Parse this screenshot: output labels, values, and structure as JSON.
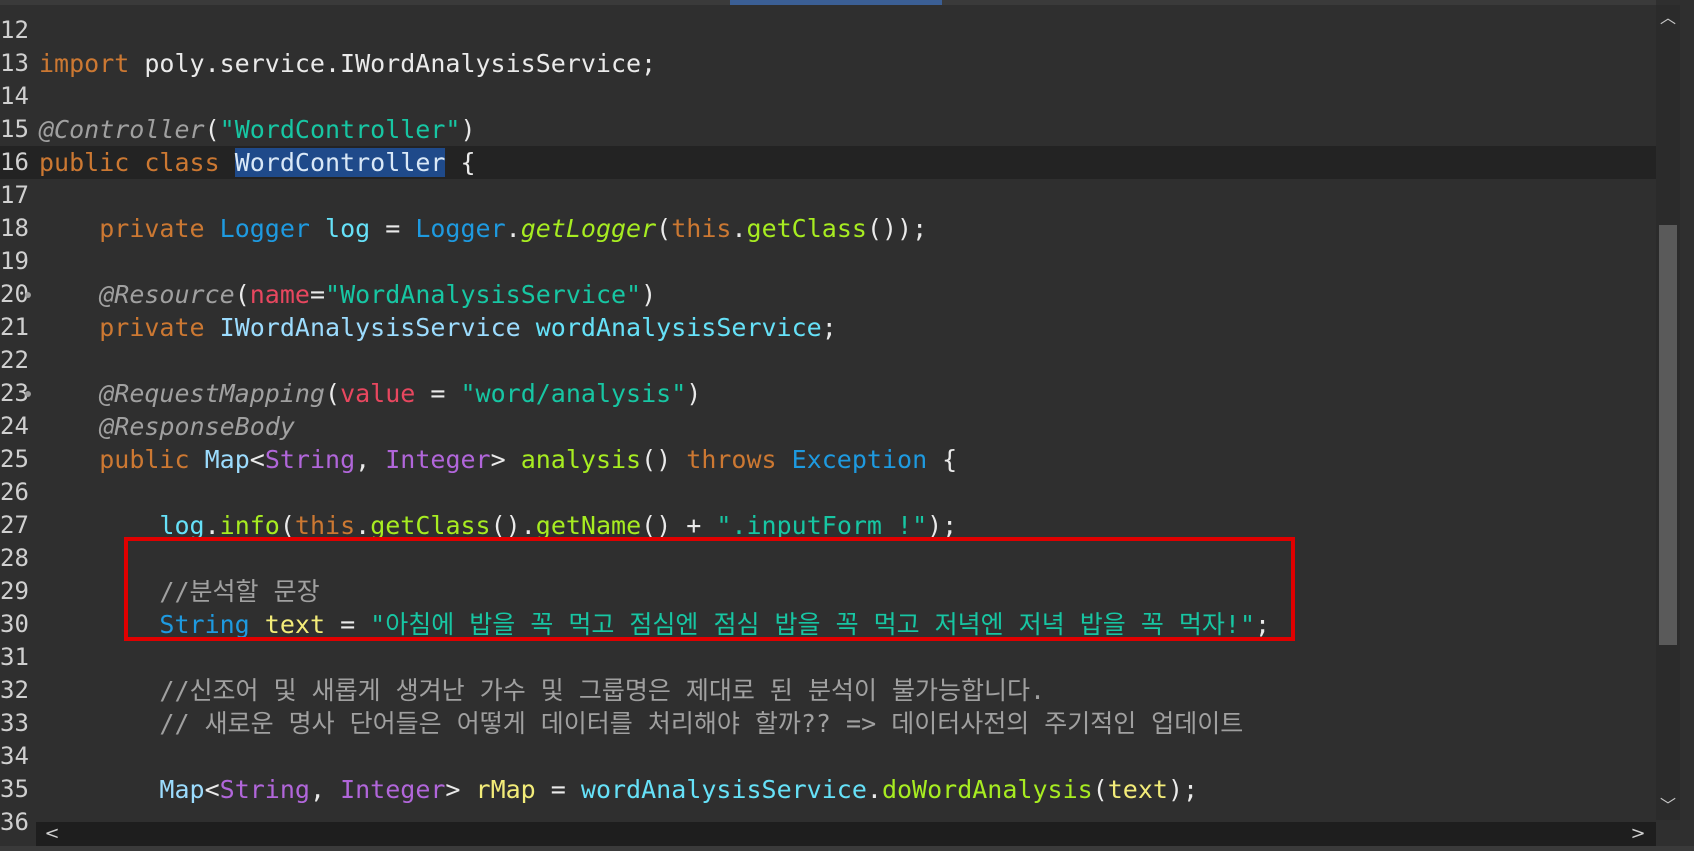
{
  "colors": {
    "background": "#2f2f2f",
    "current_line": "#232323",
    "selection": "#1f4a8a",
    "keyword": "#cc7832",
    "string": "#17c6a3",
    "comment": "#a0a0a0",
    "highlight_box": "#e00000"
  },
  "lines": [
    {
      "n": "12"
    },
    {
      "n": "13",
      "tokens": [
        {
          "c": "kw",
          "t": "import"
        },
        {
          "c": "plain",
          "t": " poly.service.IWordAnalysisService;"
        }
      ]
    },
    {
      "n": "14"
    },
    {
      "n": "15",
      "tokens": [
        {
          "c": "ann",
          "t": "@Controller"
        },
        {
          "c": "plain",
          "t": "("
        },
        {
          "c": "str",
          "t": "\"WordController\""
        },
        {
          "c": "plain",
          "t": ")"
        }
      ]
    },
    {
      "n": "16",
      "current": true,
      "tokens": [
        {
          "c": "kw",
          "t": "public"
        },
        {
          "c": "plain",
          "t": " "
        },
        {
          "c": "kw",
          "t": "class"
        },
        {
          "c": "plain",
          "t": " "
        },
        {
          "c": "sel",
          "t": "WordController"
        },
        {
          "c": "plain",
          "t": " {"
        }
      ]
    },
    {
      "n": "17"
    },
    {
      "n": "18",
      "tokens": [
        {
          "c": "plain",
          "t": "    "
        },
        {
          "c": "kw",
          "t": "private"
        },
        {
          "c": "plain",
          "t": " "
        },
        {
          "c": "type",
          "t": "Logger"
        },
        {
          "c": "plain",
          "t": " "
        },
        {
          "c": "field",
          "t": "log"
        },
        {
          "c": "plain",
          "t": " = "
        },
        {
          "c": "type",
          "t": "Logger"
        },
        {
          "c": "plain",
          "t": "."
        },
        {
          "c": "fnit",
          "t": "getLogger"
        },
        {
          "c": "plain",
          "t": "("
        },
        {
          "c": "kw",
          "t": "this"
        },
        {
          "c": "plain",
          "t": "."
        },
        {
          "c": "fn",
          "t": "getClass"
        },
        {
          "c": "plain",
          "t": "());"
        }
      ]
    },
    {
      "n": "19"
    },
    {
      "n": "20",
      "fold": true,
      "tokens": [
        {
          "c": "plain",
          "t": "    "
        },
        {
          "c": "ann",
          "t": "@Resource"
        },
        {
          "c": "plain",
          "t": "("
        },
        {
          "c": "attr",
          "t": "name"
        },
        {
          "c": "plain",
          "t": "="
        },
        {
          "c": "str",
          "t": "\"WordAnalysisService\""
        },
        {
          "c": "plain",
          "t": ")"
        }
      ]
    },
    {
      "n": "21",
      "tokens": [
        {
          "c": "plain",
          "t": "    "
        },
        {
          "c": "kw",
          "t": "private"
        },
        {
          "c": "plain",
          "t": " "
        },
        {
          "c": "type2",
          "t": "IWordAnalysisService"
        },
        {
          "c": "plain",
          "t": " "
        },
        {
          "c": "field",
          "t": "wordAnalysisService"
        },
        {
          "c": "plain",
          "t": ";"
        }
      ]
    },
    {
      "n": "22"
    },
    {
      "n": "23",
      "fold": true,
      "tokens": [
        {
          "c": "plain",
          "t": "    "
        },
        {
          "c": "ann",
          "t": "@RequestMapping"
        },
        {
          "c": "plain",
          "t": "("
        },
        {
          "c": "attr",
          "t": "value"
        },
        {
          "c": "plain",
          "t": " = "
        },
        {
          "c": "str",
          "t": "\"word/analysis\""
        },
        {
          "c": "plain",
          "t": ")"
        }
      ]
    },
    {
      "n": "24",
      "tokens": [
        {
          "c": "plain",
          "t": "    "
        },
        {
          "c": "ann",
          "t": "@ResponseBody"
        }
      ]
    },
    {
      "n": "25",
      "tokens": [
        {
          "c": "plain",
          "t": "    "
        },
        {
          "c": "kw",
          "t": "public"
        },
        {
          "c": "plain",
          "t": " "
        },
        {
          "c": "type2",
          "t": "Map"
        },
        {
          "c": "plain",
          "t": "<"
        },
        {
          "c": "gen",
          "t": "String"
        },
        {
          "c": "plain",
          "t": ", "
        },
        {
          "c": "gen",
          "t": "Integer"
        },
        {
          "c": "plain",
          "t": "> "
        },
        {
          "c": "fn",
          "t": "analysis"
        },
        {
          "c": "plain",
          "t": "() "
        },
        {
          "c": "kw",
          "t": "throws"
        },
        {
          "c": "plain",
          "t": " "
        },
        {
          "c": "type",
          "t": "Exception"
        },
        {
          "c": "plain",
          "t": " {"
        }
      ]
    },
    {
      "n": "26"
    },
    {
      "n": "27",
      "tokens": [
        {
          "c": "plain",
          "t": "        "
        },
        {
          "c": "field",
          "t": "log"
        },
        {
          "c": "plain",
          "t": "."
        },
        {
          "c": "fn",
          "t": "info"
        },
        {
          "c": "plain",
          "t": "("
        },
        {
          "c": "kw",
          "t": "this"
        },
        {
          "c": "plain",
          "t": "."
        },
        {
          "c": "fn",
          "t": "getClass"
        },
        {
          "c": "plain",
          "t": "()."
        },
        {
          "c": "fn",
          "t": "getName"
        },
        {
          "c": "plain",
          "t": "() + "
        },
        {
          "c": "str",
          "t": "\".inputForm !\""
        },
        {
          "c": "plain",
          "t": ");"
        }
      ]
    },
    {
      "n": "28"
    },
    {
      "n": "29",
      "tokens": [
        {
          "c": "plain",
          "t": "        "
        },
        {
          "c": "cmt",
          "t": "//분석할 문장"
        }
      ]
    },
    {
      "n": "30",
      "tokens": [
        {
          "c": "plain",
          "t": "        "
        },
        {
          "c": "type",
          "t": "String"
        },
        {
          "c": "plain",
          "t": " "
        },
        {
          "c": "loc",
          "t": "text"
        },
        {
          "c": "plain",
          "t": " = "
        },
        {
          "c": "str",
          "t": "\"아침에 밥을 꼭 먹고 점심엔 점심 밥을 꼭 먹고 저녁엔 저녁 밥을 꼭 먹자!\""
        },
        {
          "c": "plain",
          "t": ";"
        }
      ]
    },
    {
      "n": "31"
    },
    {
      "n": "32",
      "tokens": [
        {
          "c": "plain",
          "t": "        "
        },
        {
          "c": "cmt",
          "t": "//신조어 및 새롭게 생겨난 가수 및 그룹명은 제대로 된 분석이 불가능합니다."
        }
      ]
    },
    {
      "n": "33",
      "tokens": [
        {
          "c": "plain",
          "t": "        "
        },
        {
          "c": "cmt",
          "t": "// 새로운 명사 단어들은 어떻게 데이터를 처리해야 할까?? => 데이터사전의 주기적인 업데이트"
        }
      ]
    },
    {
      "n": "34"
    },
    {
      "n": "35",
      "tokens": [
        {
          "c": "plain",
          "t": "        "
        },
        {
          "c": "type2",
          "t": "Map"
        },
        {
          "c": "plain",
          "t": "<"
        },
        {
          "c": "gen",
          "t": "String"
        },
        {
          "c": "plain",
          "t": ", "
        },
        {
          "c": "gen",
          "t": "Integer"
        },
        {
          "c": "plain",
          "t": "> "
        },
        {
          "c": "loc",
          "t": "rMap"
        },
        {
          "c": "plain",
          "t": " = "
        },
        {
          "c": "field",
          "t": "wordAnalysisService"
        },
        {
          "c": "plain",
          "t": "."
        },
        {
          "c": "fn",
          "t": "doWordAnalysis"
        },
        {
          "c": "plain",
          "t": "("
        },
        {
          "c": "loc",
          "t": "text"
        },
        {
          "c": "plain",
          "t": ");"
        }
      ]
    },
    {
      "n": "36"
    }
  ]
}
